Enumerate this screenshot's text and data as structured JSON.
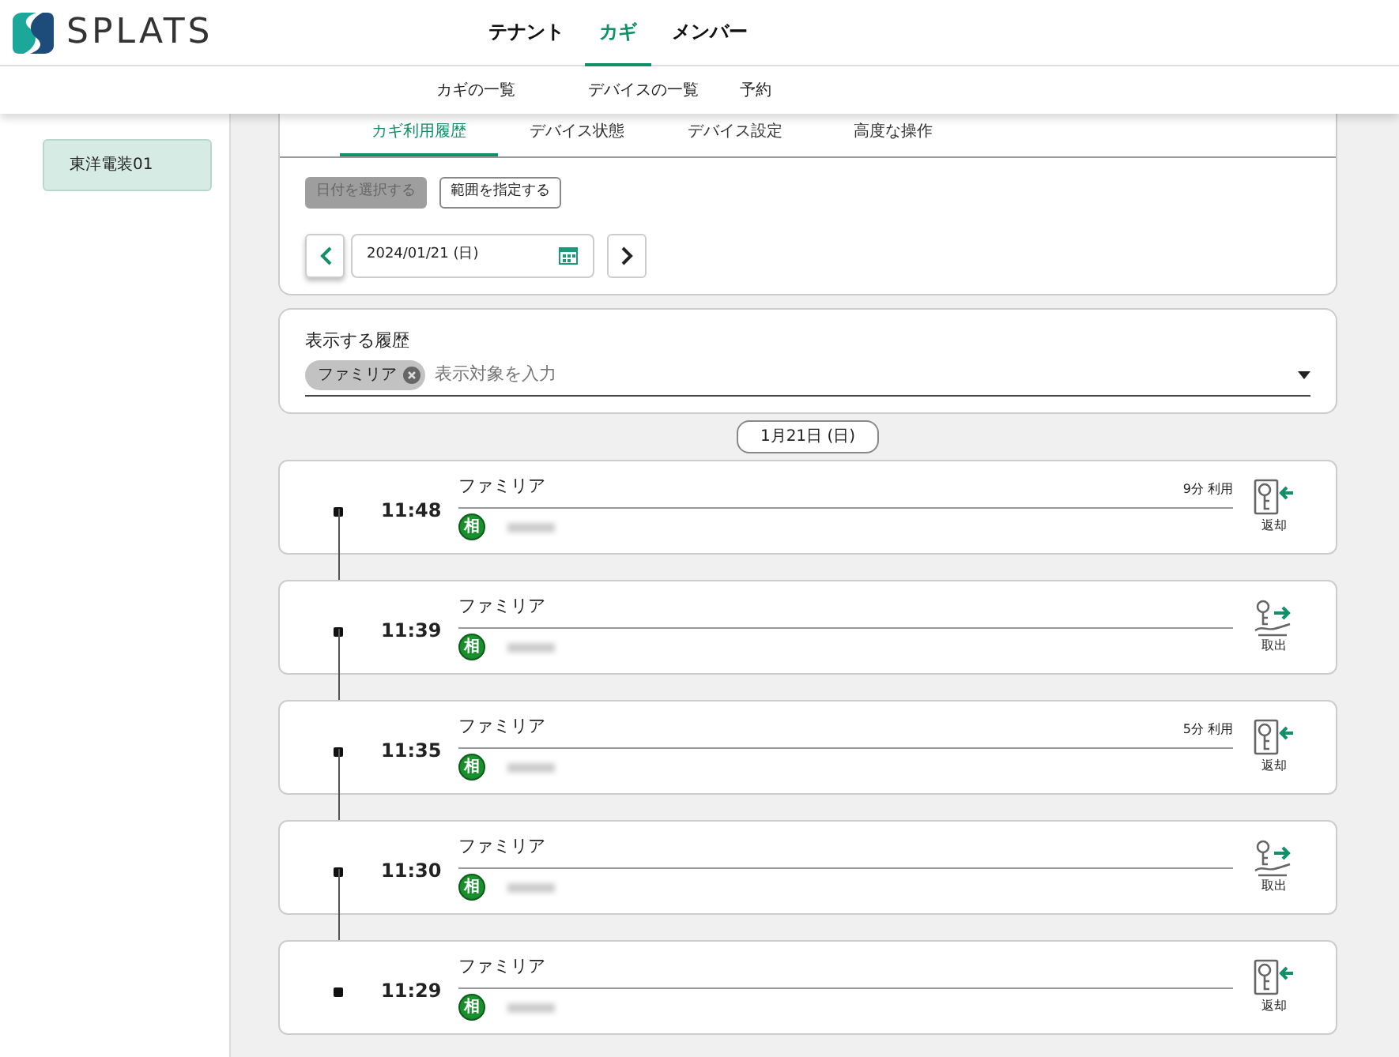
{
  "logo": {
    "text": "SPLATS"
  },
  "main_nav": [
    {
      "label": "テナント",
      "selected": false
    },
    {
      "label": "カギ",
      "selected": true
    },
    {
      "label": "メンバー",
      "selected": false
    }
  ],
  "sub_nav": [
    {
      "label": "カギの一覧"
    },
    {
      "label": "デバイスの一覧"
    },
    {
      "label": "予約"
    }
  ],
  "sidebar": {
    "items": [
      {
        "label": "東洋電装01",
        "selected": true
      }
    ]
  },
  "tabs": [
    {
      "label": "カギ利用履歴",
      "selected": true
    },
    {
      "label": "デバイス状態",
      "selected": false
    },
    {
      "label": "デバイス設定",
      "selected": false
    },
    {
      "label": "高度な操作",
      "selected": false
    }
  ],
  "mode_buttons": [
    {
      "label": "日付を選択する",
      "disabled": true
    },
    {
      "label": "範囲を指定する",
      "disabled": false
    }
  ],
  "date_field": {
    "value": "2024/01/21 (日)"
  },
  "history_filter": {
    "label": "表示する履歴",
    "chips": [
      {
        "label": "ファミリア"
      }
    ],
    "placeholder": "表示対象を入力"
  },
  "date_header": "1月21日 (日)",
  "events": [
    {
      "time": "11:48",
      "title": "ファミリア",
      "duration": "9分 利用",
      "user_badge": "相",
      "kind": "return",
      "action": "返却"
    },
    {
      "time": "11:39",
      "title": "ファミリア",
      "user_badge": "相",
      "kind": "takeout",
      "action": "取出"
    },
    {
      "time": "11:35",
      "title": "ファミリア",
      "duration": "5分 利用",
      "user_badge": "相",
      "kind": "return",
      "action": "返却"
    },
    {
      "time": "11:30",
      "title": "ファミリア",
      "user_badge": "相",
      "kind": "takeout",
      "action": "取出"
    },
    {
      "time": "11:29",
      "title": "ファミリア",
      "user_badge": "相",
      "kind": "return",
      "action": "返却"
    }
  ]
}
